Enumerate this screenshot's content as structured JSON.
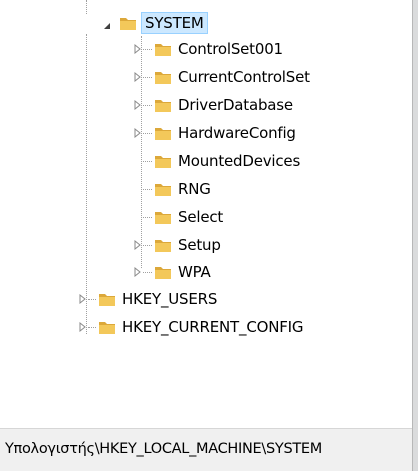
{
  "tree": {
    "selected": "SYSTEM",
    "items": [
      {
        "label": "SYSTEM",
        "expanded": true,
        "icon": "folder-icon"
      },
      {
        "label": "ControlSet001",
        "icon": "folder-icon",
        "has_children": true
      },
      {
        "label": "CurrentControlSet",
        "icon": "folder-icon",
        "has_children": true
      },
      {
        "label": "DriverDatabase",
        "icon": "folder-icon",
        "has_children": true
      },
      {
        "label": "HardwareConfig",
        "icon": "folder-icon",
        "has_children": true
      },
      {
        "label": "MountedDevices",
        "icon": "folder-icon",
        "has_children": false
      },
      {
        "label": "RNG",
        "icon": "folder-icon",
        "has_children": false
      },
      {
        "label": "Select",
        "icon": "folder-icon",
        "has_children": false
      },
      {
        "label": "Setup",
        "icon": "folder-icon",
        "has_children": true
      },
      {
        "label": "WPA",
        "icon": "folder-icon",
        "has_children": true
      },
      {
        "label": "HKEY_USERS",
        "icon": "folder-icon",
        "has_children": true
      },
      {
        "label": "HKEY_CURRENT_CONFIG",
        "icon": "folder-icon",
        "has_children": true
      }
    ]
  },
  "status_bar": {
    "path": "Υπολογιστής\\HKEY_LOCAL_MACHINE\\SYSTEM"
  },
  "colors": {
    "folder": "#e8b84a",
    "selection": "#cce8ff",
    "selection_border": "#99d1ff"
  }
}
